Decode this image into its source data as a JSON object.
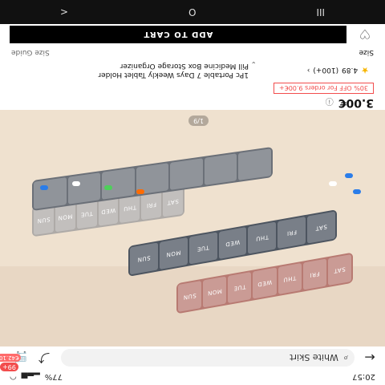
{
  "status": {
    "time": "20:57",
    "battery": "77%",
    "signal_icon": "signal-icon",
    "wifi_icon": "wifi-icon"
  },
  "search": {
    "query": "White Skirt",
    "badge_count": "99+",
    "badge_price": "€42.10"
  },
  "gallery": {
    "counter": "1/9",
    "org_labels_top": [
      "SAT",
      "FRI",
      "THU",
      "WED",
      "TUE",
      "MON",
      "SUN"
    ],
    "org_labels_mid": [
      "SAT",
      "FRI",
      "THU",
      "WED",
      "TUE",
      "MON",
      "SUN"
    ],
    "org_labels_front": [
      "SAT",
      "FRI",
      "THU",
      "WED",
      "TUE",
      "MON",
      "SUN"
    ],
    "pill_colors": [
      "#2b7de9",
      "#ffffff",
      "#ff6b00",
      "#4ed05a"
    ]
  },
  "product": {
    "price": "3.00€",
    "promo": "30% OFF For orders 9.00€+",
    "title_line1": "1Pc Portable 7 Days Weekly Tablet Holder",
    "title_line2": "Pill Medicine Box Storage Organizer",
    "rating": "4.89",
    "reviews": "(100+)"
  },
  "size": {
    "label": "Size",
    "guide": "Size Guide"
  },
  "actions": {
    "add_to_cart": "ADD TO CART"
  },
  "nav": {
    "back": "<",
    "home": "O",
    "recents": "III"
  }
}
